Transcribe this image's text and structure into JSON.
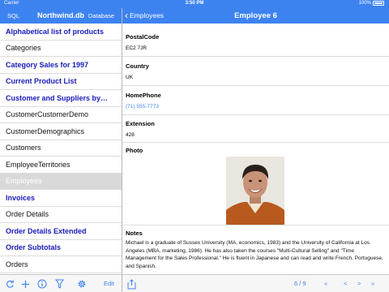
{
  "status_bar": {
    "carrier": "Carrier",
    "time": "3:50 PM",
    "battery": "100%"
  },
  "master_nav": {
    "left_button": "SQL",
    "title": "Northwind.db",
    "right_button": "Database"
  },
  "detail_nav": {
    "back_label": "Employees",
    "title": "Employee 6"
  },
  "list": {
    "items": [
      {
        "label": "Alphabetical list of products",
        "kind": "view"
      },
      {
        "label": "Categories",
        "kind": "table"
      },
      {
        "label": "Category Sales for 1997",
        "kind": "view"
      },
      {
        "label": "Current Product List",
        "kind": "view"
      },
      {
        "label": "Customer and Suppliers by…",
        "kind": "view"
      },
      {
        "label": "CustomerCustomerDemo",
        "kind": "table"
      },
      {
        "label": "CustomerDemographics",
        "kind": "table"
      },
      {
        "label": "Customers",
        "kind": "table"
      },
      {
        "label": "EmployeeTerritories",
        "kind": "table"
      },
      {
        "label": "Employees",
        "kind": "selected"
      },
      {
        "label": "Invoices",
        "kind": "view"
      },
      {
        "label": "Order Details",
        "kind": "table"
      },
      {
        "label": "Order Details Extended",
        "kind": "view"
      },
      {
        "label": "Order Subtotals",
        "kind": "view"
      },
      {
        "label": "Orders",
        "kind": "table"
      }
    ]
  },
  "detail": {
    "postal_code": {
      "label": "PostalCode",
      "value": "EC2 7JR"
    },
    "country": {
      "label": "Country",
      "value": "UK"
    },
    "home_phone": {
      "label": "HomePhone",
      "value": "(71) 555-7773"
    },
    "extension": {
      "label": "Extension",
      "value": "428"
    },
    "photo": {
      "label": "Photo"
    },
    "notes": {
      "label": "Notes",
      "value": "Michael is a graduate of Sussex University (MA, economics, 1983) and the University of California at Los Angeles (MBA, marketing, 1986).  He has also taken the courses \"Multi-Cultural Selling\" and \"Time Management for the Sales Professional.\"  He is fluent in Japanese and can read and write French, Portuguese, and Spanish."
    }
  },
  "toolbar_left": {
    "edit_label": "Edit",
    "icons": [
      "refresh-icon",
      "add-icon",
      "info-icon",
      "filter-icon",
      "gear-icon"
    ]
  },
  "toolbar_right": {
    "page_indicator": "6 / 9",
    "nav": [
      "«",
      "<",
      ">",
      "»"
    ]
  },
  "colors": {
    "accent": "#3d83f0",
    "view_text": "#1a1ab8",
    "selected_row": "#d9d9d9"
  }
}
